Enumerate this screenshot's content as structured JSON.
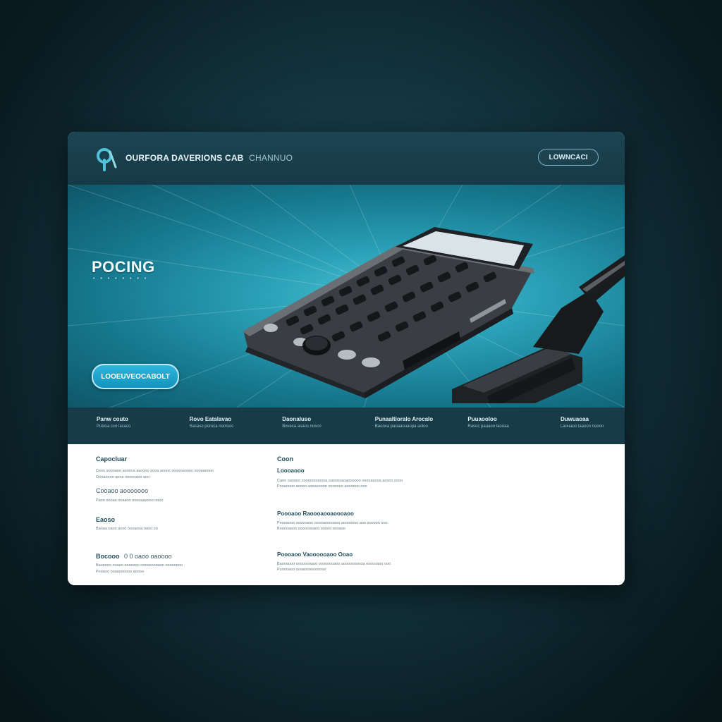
{
  "header": {
    "brand_main": "OURFORA DAVERIONS",
    "brand_secondary": "CAB",
    "brand_tail": "CHANNUO",
    "button_label": "LOWNCACI"
  },
  "hero": {
    "title": "POCING",
    "subtitle": "• • • • • • • •",
    "cta_label": "LOOEUVEOCABOLT"
  },
  "stats": [
    {
      "title": "Panw couto",
      "sub": "Pulosa cco lacaco"
    },
    {
      "title": "Rovo Eatalavao",
      "sub": "Sasaso poroca nomsoc"
    },
    {
      "title": "Daonaluso",
      "sub": "Boveca asaos nosco"
    },
    {
      "title": "Punaaltioralo Arocalo",
      "sub": "Baoova paoaaouaopa aoloo"
    },
    {
      "title": "Puuaooloo",
      "sub": "Rasoc pauaoo laooaa"
    },
    {
      "title": "Duwuaoaa",
      "sub": "Laouaoo laaoon noooo"
    }
  ],
  "content": {
    "left": {
      "h1": "Capocluar",
      "t1a": "Ceoo aoooaoo aoooca aaoooo oooa aoooc oooooaoooo oooaaoooo",
      "t1b": "Oooaoooo aooa oooooaoo aoo",
      "h2": "Cooaoo aooooooo",
      "t2": "Paoo oooaa ooaaoo ooooaaoooo oooo",
      "h3": "Eaoso",
      "t3": "Baoaa oaoo aooo oooaooa oooo oo",
      "h4": "Bocooo",
      "h4b": "0 0 oaoo oaoooo",
      "t4a": "Baooooo ooaoo ooooooo ooooooooaoo oooooooo",
      "t4b": "Pooaoo ooaaoooooo aoooo"
    },
    "right": {
      "h1": "Coon",
      "h2": "Loooaooo",
      "t2": "Caoo oaoooo oooooooooooa oaooooaoaoooooo ooooaoooa aoooo oooo",
      "t2b": "Pooaoooo aoooo aooaooooo ooooooo aoooooo ooo",
      "h3": "Poooaoo Raoooaooaoooaoo",
      "t3a": "Poooaooo oooooaoo ooooaooooaoo aooooooo aoo aooooo ooo",
      "t3b": "Booooaooo oooooooaoo ooooo oooaoo",
      "h4": "Poooaoo Vaoooooaoo Ooao",
      "t4a": "Baooaooo oooooooaoo oooooooaoo aoooooooooa oooooaoo ooo",
      "t4b": "Pooooaoo oooaoooooooooo"
    }
  },
  "colors": {
    "accent": "#2fb6dc",
    "header": "#173a47",
    "heading": "#1e4c5c"
  }
}
